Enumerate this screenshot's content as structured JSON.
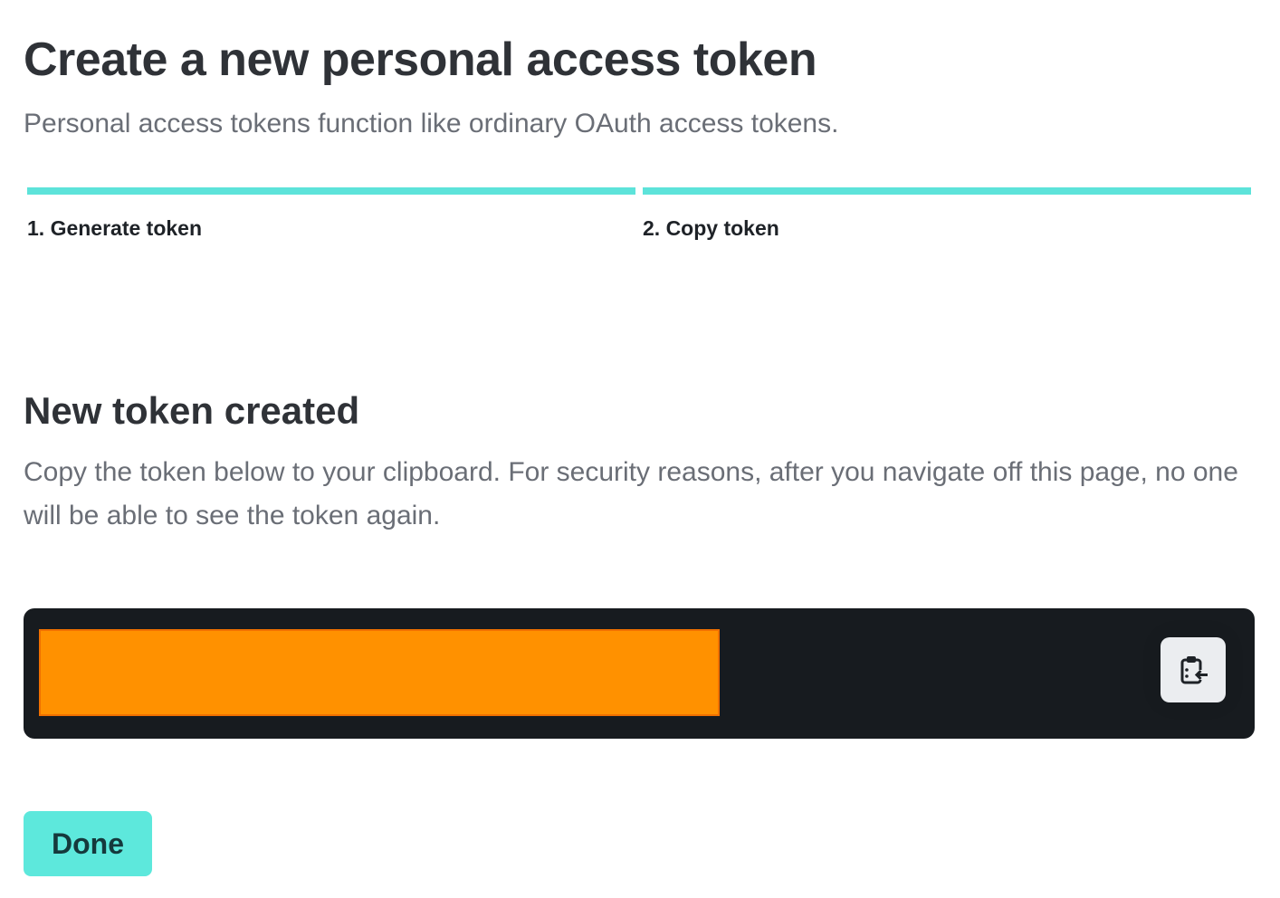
{
  "header": {
    "title": "Create a new personal access token",
    "subtitle": "Personal access tokens function like ordinary OAuth access tokens."
  },
  "stepper": {
    "steps": [
      {
        "label": "1. Generate token",
        "completed": true
      },
      {
        "label": "2. Copy token",
        "completed": true
      }
    ],
    "accent_color": "#5de3da"
  },
  "result": {
    "title": "New token created",
    "description": "Copy the token below to your clipboard. For security reasons, after you navigate off this page, no one will be able to see the token again.",
    "token_redaction_color": "#ff9100",
    "copy_icon": "clipboard-copy-icon"
  },
  "actions": {
    "done_label": "Done"
  }
}
